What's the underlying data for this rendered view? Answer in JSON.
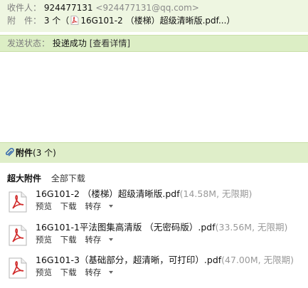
{
  "header": {
    "recipient_label": "收件人：",
    "recipient_name": "924477131",
    "recipient_email": "<924477131@qq.com>",
    "attach_label": "附　件：",
    "attach_count": "3 个",
    "attach_open": "（",
    "attach_preview": "16G101-2 （楼梯）超级清晰版.pdf...",
    "attach_close": "）"
  },
  "status": {
    "label": "发送状态：",
    "value": "投递成功",
    "link": "[查看详情]"
  },
  "attachments": {
    "title": "附件",
    "count": "(3 个)",
    "group_label": "超大附件",
    "download_all": "全部下载",
    "files": [
      {
        "name": "16G101-2 （楼梯）超级清晰版.pdf",
        "meta": "(14.58M, 无限期)",
        "preview": "预览",
        "download": "下载",
        "save": "转存"
      },
      {
        "name": "16G101-1平法图集高清版 （无密码版）.pdf",
        "meta": "(33.56M, 无限期)",
        "preview": "预览",
        "download": "下载",
        "save": "转存"
      },
      {
        "name": "16G101-3（基础部分，超清晰，可打印）.pdf",
        "meta": "(47.00M, 无限期)",
        "preview": "预览",
        "download": "下载",
        "save": "转存"
      }
    ]
  }
}
